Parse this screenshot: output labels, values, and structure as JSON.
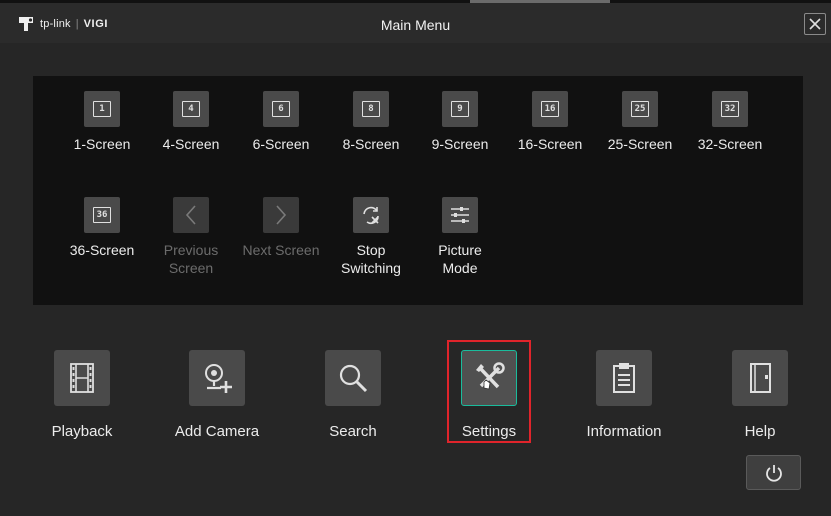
{
  "header": {
    "logo": {
      "brand": "tp-link",
      "separator": "|",
      "product": "VIGI"
    },
    "title": "Main Menu"
  },
  "screen_layouts": [
    {
      "icon_text": "1",
      "label": "1-Screen"
    },
    {
      "icon_text": "4",
      "label": "4-Screen"
    },
    {
      "icon_text": "6",
      "label": "6-Screen"
    },
    {
      "icon_text": "8",
      "label": "8-Screen"
    },
    {
      "icon_text": "9",
      "label": "9-Screen"
    },
    {
      "icon_text": "16",
      "label": "16-Screen"
    },
    {
      "icon_text": "25",
      "label": "25-Screen"
    },
    {
      "icon_text": "32",
      "label": "32-Screen"
    },
    {
      "icon_text": "36",
      "label": "36-Screen"
    }
  ],
  "view_controls": {
    "previous": {
      "line1": "Previous",
      "line2": "Screen",
      "enabled": false
    },
    "next": {
      "label": "Next Screen",
      "enabled": false
    },
    "stop": {
      "line1": "Stop",
      "line2": "Switching"
    },
    "picture": {
      "line1": "Picture",
      "line2": "Mode"
    }
  },
  "main_functions": [
    {
      "label": "Playback",
      "icon": "film-icon"
    },
    {
      "label": "Add Camera",
      "icon": "add-camera-icon"
    },
    {
      "label": "Search",
      "icon": "magnifier-icon"
    },
    {
      "label": "Settings",
      "icon": "tools-icon",
      "selected": true
    },
    {
      "label": "Information",
      "icon": "clipboard-icon"
    },
    {
      "label": "Help",
      "icon": "book-icon"
    }
  ],
  "colors": {
    "background": "#262626",
    "panel": "#111111",
    "selected_border": "#1abc9c",
    "highlight": "#e0242b"
  }
}
